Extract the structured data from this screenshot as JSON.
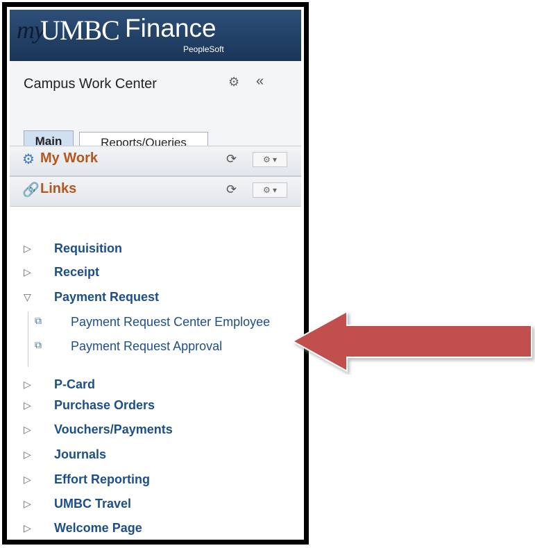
{
  "header": {
    "brand_my": "my",
    "brand_umbc": "UMBC",
    "brand_finance": "Finance",
    "brand_sub": "PeopleSoft"
  },
  "titlebar": {
    "title": "Campus Work Center",
    "gear_glyph": "⚙",
    "collapse_glyph": "«"
  },
  "tabs": [
    {
      "label": "Main",
      "active": true
    },
    {
      "label": "Reports/Queries",
      "active": false
    }
  ],
  "pagelets": [
    {
      "title": "My Work",
      "icon": "gears-icon",
      "icon_glyph": "⚙",
      "refresh_glyph": "⟳",
      "menu_glyph": "⚙ ▾"
    },
    {
      "title": "Links",
      "icon": "link-icon",
      "icon_glyph": "🔗",
      "refresh_glyph": "⟳",
      "menu_glyph": "⚙ ▾"
    }
  ],
  "links": [
    {
      "label": "Requisition",
      "expanded": false
    },
    {
      "label": "Receipt",
      "expanded": false
    },
    {
      "label": "Payment Request",
      "expanded": true,
      "children": [
        {
          "label": "Payment Request Center Employee"
        },
        {
          "label": "Payment Request Approval"
        }
      ]
    },
    {
      "label": "P-Card",
      "expanded": false
    },
    {
      "label": "Purchase Orders",
      "expanded": false
    },
    {
      "label": "Vouchers/Payments",
      "expanded": false
    },
    {
      "label": "Journals",
      "expanded": false
    },
    {
      "label": "Effort Reporting",
      "expanded": false
    },
    {
      "label": "UMBC Travel",
      "expanded": false
    },
    {
      "label": "Welcome Page",
      "expanded": false
    }
  ],
  "glyphs": {
    "collapsed_arrow": "▷",
    "expanded_arrow": "▽",
    "doc_icon": "⧉"
  },
  "colors": {
    "banner": "#1f3c62",
    "link_blue": "#1c4f8a",
    "pagelet_title": "#b5561e",
    "pointer_red": "#c0504d"
  }
}
